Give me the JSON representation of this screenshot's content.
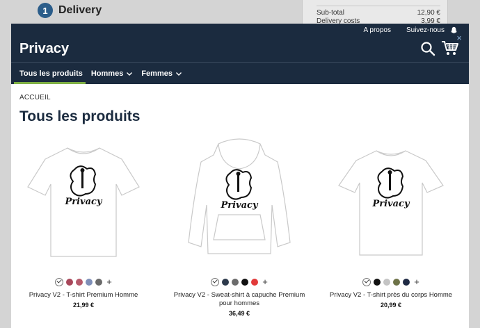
{
  "background": {
    "step_number": "1",
    "step_title": "Delivery",
    "summary": [
      {
        "label": "Sub-total",
        "value": "12,90 €"
      },
      {
        "label": "Delivery costs",
        "value": "3,99 €"
      }
    ]
  },
  "header": {
    "links": [
      "A propos",
      "Suivez-nous"
    ],
    "brand": "Privacy",
    "close_symbol": "×"
  },
  "nav": {
    "items": [
      {
        "label": "Tous les produits",
        "has_chevron": false
      },
      {
        "label": "Hommes",
        "has_chevron": true
      },
      {
        "label": "Femmes",
        "has_chevron": true
      }
    ]
  },
  "breadcrumb": "ACCUEIL",
  "title": "Tous les produits",
  "plus_symbol": "+",
  "products": [
    {
      "name": "Privacy V2 - T-shirt Premium Homme",
      "price": "21,99 €",
      "type": "tshirt-premium",
      "colors": [
        "#ffffff",
        "#a8475a",
        "#b55a6b",
        "#7f8fb8",
        "#6a6a6a"
      ]
    },
    {
      "name": "Privacy V2 - Sweat-shirt à capuche Premium pour hommes",
      "price": "36,49 €",
      "type": "hoodie",
      "colors": [
        "#ffffff",
        "#2d3a4c",
        "#6c6c6c",
        "#111111",
        "#e23a3a"
      ]
    },
    {
      "name": "Privacy V2 - T-shirt près du corps Homme",
      "price": "20,99 €",
      "type": "tshirt-fitted",
      "colors": [
        "#ffffff",
        "#111111",
        "#c4c4c4",
        "#6e7348",
        "#1f2a44"
      ]
    }
  ],
  "colors": {
    "header_bg": "#1b2b3f",
    "active_underline": "#7fb045",
    "title": "#1b2b3f"
  }
}
